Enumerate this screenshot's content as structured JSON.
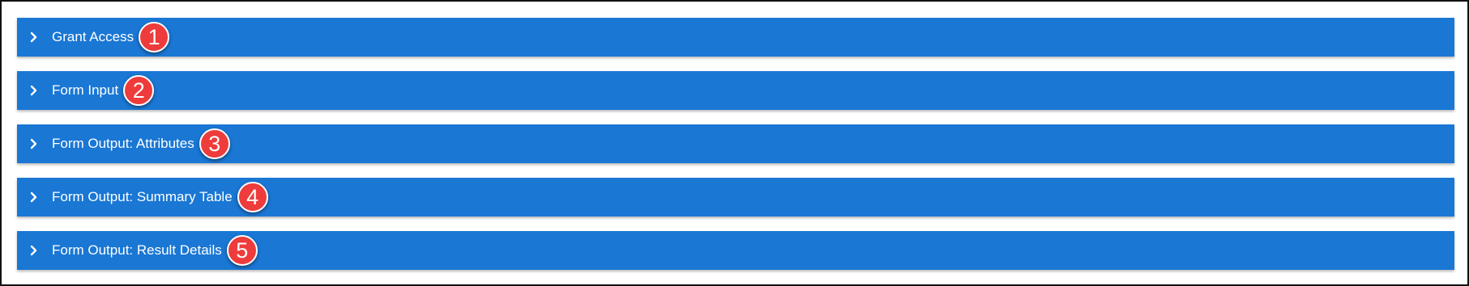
{
  "colors": {
    "header_background": "#1a77d4",
    "header_text": "#ffffff",
    "badge_background": "#ee3b3b",
    "badge_border": "#ffffff"
  },
  "accordion": {
    "panels": [
      {
        "title": "Grant Access",
        "step": "1",
        "icon": "chevron-right-icon"
      },
      {
        "title": "Form Input",
        "step": "2",
        "icon": "chevron-right-icon"
      },
      {
        "title": "Form Output: Attributes",
        "step": "3",
        "icon": "chevron-right-icon"
      },
      {
        "title": "Form Output: Summary Table",
        "step": "4",
        "icon": "chevron-right-icon"
      },
      {
        "title": "Form Output: Result Details",
        "step": "5",
        "icon": "chevron-right-icon"
      }
    ]
  }
}
